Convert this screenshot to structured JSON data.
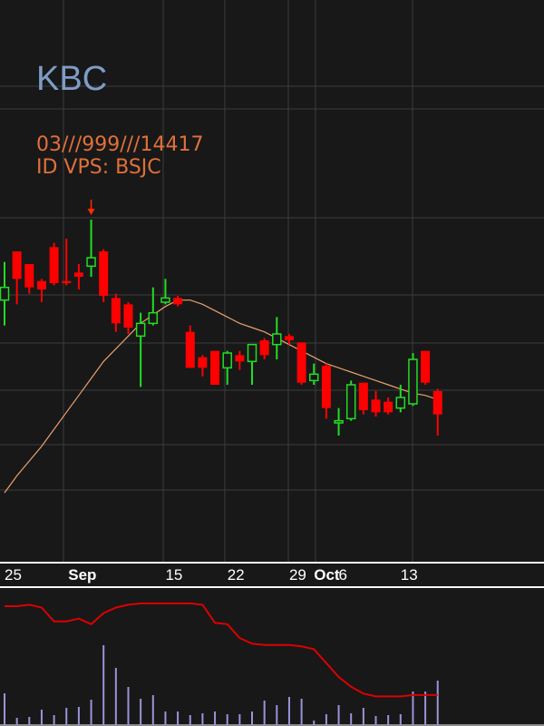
{
  "header": {
    "symbol": "KBC",
    "line1": "03///999///14417",
    "line2": "ID VPS: BSJC"
  },
  "colors": {
    "background": "#181818",
    "grid": "#3c3c3c",
    "up": "#22dd22",
    "down": "#ff0000",
    "ma": "#e8a070",
    "indicator_line": "#dd0000",
    "volume": "#9a94d8",
    "axis_text": "#ffffff",
    "arrow": "#ff2a00",
    "ticker": "#7f9cc6",
    "info_text": "#e0703a"
  },
  "chart_data": {
    "type": "candlestick",
    "x_ticks": [
      {
        "label": "25",
        "bold": false,
        "at": 0
      },
      {
        "label": "Sep",
        "bold": true,
        "at": 5
      },
      {
        "label": "15",
        "bold": false,
        "at": 13
      },
      {
        "label": "22",
        "bold": false,
        "at": 18
      },
      {
        "label": "29",
        "bold": false,
        "at": 23
      },
      {
        "label": "Oct",
        "bold": true,
        "at": 25
      },
      {
        "label": "6",
        "bold": false,
        "at": 27
      },
      {
        "label": "13",
        "bold": false,
        "at": 32
      }
    ],
    "candles": [
      {
        "o": 18.7,
        "h": 20.5,
        "l": 17.5,
        "c": 19.3
      },
      {
        "o": 21.0,
        "h": 21.0,
        "l": 18.5,
        "c": 19.7
      },
      {
        "o": 20.4,
        "h": 20.4,
        "l": 19.0,
        "c": 19.3
      },
      {
        "o": 19.6,
        "h": 19.7,
        "l": 18.6,
        "c": 19.2
      },
      {
        "o": 21.2,
        "h": 21.4,
        "l": 19.4,
        "c": 19.5
      },
      {
        "o": 19.6,
        "h": 21.6,
        "l": 19.4,
        "c": 19.5
      },
      {
        "o": 20.0,
        "h": 20.4,
        "l": 19.2,
        "c": 19.8
      },
      {
        "o": 20.3,
        "h": 22.5,
        "l": 19.8,
        "c": 20.7
      },
      {
        "o": 21.0,
        "h": 21.1,
        "l": 18.6,
        "c": 18.9
      },
      {
        "o": 18.8,
        "h": 19.0,
        "l": 17.2,
        "c": 17.6
      },
      {
        "o": 18.5,
        "h": 18.6,
        "l": 17.1,
        "c": 17.4
      },
      {
        "o": 17.0,
        "h": 18.1,
        "l": 14.6,
        "c": 17.6
      },
      {
        "o": 17.6,
        "h": 19.3,
        "l": 17.5,
        "c": 18.1
      },
      {
        "o": 18.6,
        "h": 19.7,
        "l": 18.5,
        "c": 18.8
      },
      {
        "o": 18.8,
        "h": 18.9,
        "l": 18.4,
        "c": 18.5
      },
      {
        "o": 17.2,
        "h": 17.5,
        "l": 15.5,
        "c": 15.5
      },
      {
        "o": 16.0,
        "h": 16.1,
        "l": 15.1,
        "c": 15.5
      },
      {
        "o": 16.3,
        "h": 16.3,
        "l": 14.7,
        "c": 14.7
      },
      {
        "o": 15.5,
        "h": 16.3,
        "l": 14.7,
        "c": 16.2
      },
      {
        "o": 16.1,
        "h": 16.3,
        "l": 15.4,
        "c": 15.8
      },
      {
        "o": 15.8,
        "h": 16.5,
        "l": 14.7,
        "c": 16.6
      },
      {
        "o": 16.8,
        "h": 16.9,
        "l": 15.9,
        "c": 16.1
      },
      {
        "o": 16.6,
        "h": 17.9,
        "l": 15.9,
        "c": 17.1
      },
      {
        "o": 17.0,
        "h": 17.1,
        "l": 16.6,
        "c": 16.8
      },
      {
        "o": 16.7,
        "h": 16.7,
        "l": 14.7,
        "c": 14.8
      },
      {
        "o": 14.9,
        "h": 15.7,
        "l": 14.7,
        "c": 15.2
      },
      {
        "o": 15.6,
        "h": 15.7,
        "l": 13.1,
        "c": 13.6
      },
      {
        "o": 12.9,
        "h": 13.6,
        "l": 12.3,
        "c": 13.0
      },
      {
        "o": 13.1,
        "h": 14.9,
        "l": 13.0,
        "c": 14.7
      },
      {
        "o": 14.8,
        "h": 14.8,
        "l": 13.3,
        "c": 13.5
      },
      {
        "o": 14.0,
        "h": 14.4,
        "l": 13.2,
        "c": 13.4
      },
      {
        "o": 13.9,
        "h": 14.1,
        "l": 13.3,
        "c": 13.4
      },
      {
        "o": 13.6,
        "h": 14.7,
        "l": 13.4,
        "c": 14.1
      },
      {
        "o": 13.8,
        "h": 16.2,
        "l": 13.7,
        "c": 15.9
      },
      {
        "o": 16.3,
        "h": 16.3,
        "l": 14.7,
        "c": 14.8
      },
      {
        "o": 14.4,
        "h": 14.5,
        "l": 12.3,
        "c": 13.3
      }
    ],
    "ma": [
      9.6,
      10.4,
      11.1,
      11.8,
      12.6,
      13.4,
      14.2,
      15.0,
      15.8,
      16.4,
      17.0,
      17.6,
      18.0,
      18.4,
      18.7,
      18.7,
      18.5,
      18.2,
      17.9,
      17.6,
      17.4,
      17.2,
      16.9,
      16.6,
      16.3,
      16.0,
      15.7,
      15.5,
      15.3,
      15.1,
      14.9,
      14.7,
      14.5,
      14.3,
      14.2,
      14.0
    ],
    "marker_index": 7,
    "indicator": [
      85,
      85,
      86,
      84,
      74,
      74,
      76,
      72,
      80,
      84,
      86,
      87,
      87,
      87,
      87,
      87,
      86,
      73,
      72,
      62,
      58,
      57,
      57,
      57,
      56,
      54,
      44,
      34,
      27,
      22,
      20,
      20,
      20,
      21,
      21,
      21
    ],
    "volume": [
      0.35,
      0.08,
      0.09,
      0.17,
      0.11,
      0.19,
      0.2,
      0.28,
      0.88,
      0.63,
      0.42,
      0.29,
      0.33,
      0.15,
      0.15,
      0.11,
      0.13,
      0.15,
      0.12,
      0.12,
      0.15,
      0.27,
      0.22,
      0.31,
      0.29,
      0.05,
      0.12,
      0.22,
      0.13,
      0.19,
      0.1,
      0.11,
      0.12,
      0.37,
      0.37,
      0.49
    ]
  }
}
